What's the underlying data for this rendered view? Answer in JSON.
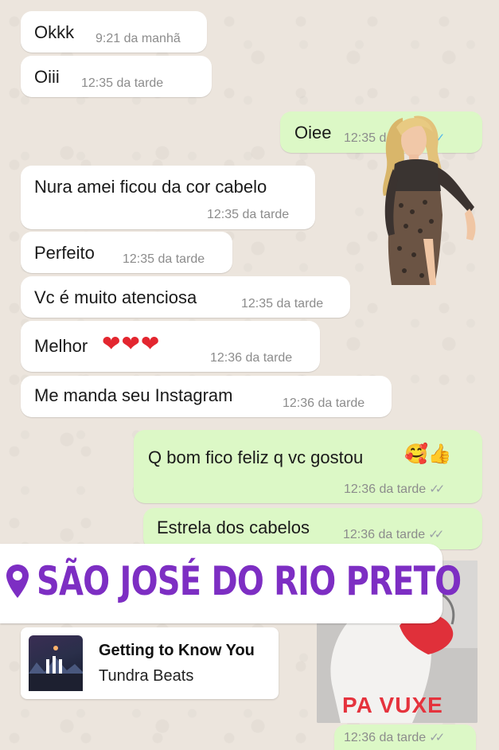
{
  "messages": [
    {
      "text": "Okkk",
      "time": "9:21 da manhã"
    },
    {
      "text": "Oiii",
      "time": "12:35 da tarde"
    },
    {
      "text": "Oiee",
      "time": "12:35 da tarde",
      "ticks": "✓✓"
    },
    {
      "text": "Nura amei ficou da cor cabelo",
      "time": "12:35 da tarde"
    },
    {
      "text": "Perfeito",
      "time": "12:35 da tarde"
    },
    {
      "text": "Vc é muito atenciosa",
      "time": "12:35 da tarde"
    },
    {
      "text": "Melhor",
      "emoji": "❤❤❤",
      "time": "12:36 da tarde"
    },
    {
      "text": "Me manda seu Instagram",
      "time": "12:36 da tarde"
    },
    {
      "text": "Q bom fico feliz q vc gostou",
      "emoji": "🥰👍",
      "time": "12:36 da tarde",
      "ticks": "✓✓"
    },
    {
      "text": "Estrela dos cabelos",
      "time": "12:36 da tarde",
      "ticks": "✓✓"
    }
  ],
  "location": {
    "name": "SÃO JOSÉ DO RIO PRETO",
    "icon": "map-pin-icon",
    "color": "#7d2ec3"
  },
  "music": {
    "title": "Getting to Know You",
    "artist": "Tundra Beats",
    "icon": "album-art"
  },
  "sticker": {
    "caption": "PA VUXE",
    "time": "12:36 da tarde",
    "ticks": "✓✓"
  },
  "colors": {
    "incoming": "#ffffff",
    "outgoing": "#dcf8c6",
    "read_ticks": "#4fb6ec"
  }
}
